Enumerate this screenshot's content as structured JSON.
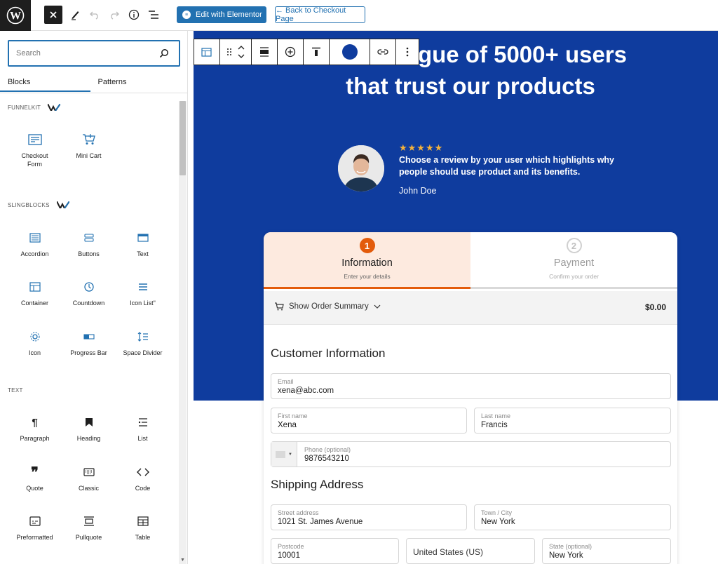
{
  "topbar": {
    "elementor_label": "Edit with Elementor",
    "back_label": "← Back to Checkout Page",
    "icons": [
      "wordpress-logo",
      "close-icon",
      "pencil-icon",
      "undo-icon",
      "redo-icon",
      "info-icon",
      "list-view-icon"
    ]
  },
  "sidebar": {
    "search_placeholder": "Search",
    "tabs": [
      "Blocks",
      "Patterns"
    ],
    "categories": [
      {
        "label": "FUNNELKIT",
        "blocks": [
          "Checkout Form",
          "Mini Cart"
        ]
      },
      {
        "label": "SLINGBLOCKS",
        "blocks": [
          "Accordion",
          "Buttons",
          "Text",
          "Container",
          "Countdown",
          "Icon List\"",
          "Icon",
          "Progress Bar",
          "Space Divider"
        ]
      },
      {
        "label": "TEXT",
        "blocks": [
          "Paragraph",
          "Heading",
          "List",
          "Quote",
          "Classic",
          "Code",
          "Preformatted",
          "Pullquote",
          "Table"
        ]
      }
    ],
    "checkout_form_label": "Checkout\nForm"
  },
  "hero": {
    "title_line1": "gue of 5000+ users",
    "title_line2": "that trust our products",
    "stars": "★★★★★",
    "review_text": "Choose a review by your user which highlights why people should use product and its benefits.",
    "reviewer": "John Doe",
    "bg_color": "#0f3c9e"
  },
  "checkout": {
    "steps": [
      {
        "num": "1",
        "title": "Information",
        "subtitle": "Enter your details"
      },
      {
        "num": "2",
        "title": "Payment",
        "subtitle": "Confirm your order"
      }
    ],
    "order_summary_label": "Show Order Summary",
    "order_total": "$0.00",
    "customer_title": "Customer Information",
    "email_label": "Email",
    "email_value": "xena@abc.com",
    "first_name_label": "First name",
    "first_name_value": "Xena",
    "last_name_label": "Last name",
    "last_name_value": "Francis",
    "phone_label": "Phone (optional)",
    "phone_value": "9876543210",
    "shipping_title": "Shipping Address",
    "street_label": "Street address",
    "street_value": "1021 St. James Avenue",
    "city_label": "Town / City",
    "city_value": "New York",
    "postcode_label": "Postcode",
    "postcode_value": "10001",
    "country_value": "United States (US)",
    "state_label": "State (optional)",
    "state_value": "New York",
    "accent_color": "#e35b0b"
  }
}
